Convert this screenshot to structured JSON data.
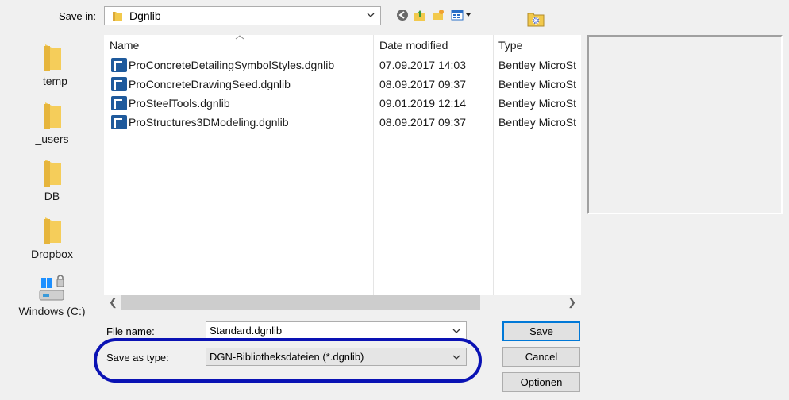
{
  "top": {
    "save_in_label": "Save in:",
    "folder": "Dgnlib"
  },
  "toolbar": {
    "icons": [
      "back-icon",
      "up-folder-icon",
      "new-folder-icon",
      "view-menu-icon",
      "project-folder-icon"
    ]
  },
  "places": [
    {
      "label": "_temp",
      "icon": "folder-icon"
    },
    {
      "label": "_users",
      "icon": "folder-icon"
    },
    {
      "label": "DB",
      "icon": "folder-icon"
    },
    {
      "label": "Dropbox",
      "icon": "folder-icon"
    },
    {
      "label": "Windows (C:)",
      "icon": "drive-icon"
    }
  ],
  "list": {
    "columns": [
      "Name",
      "Date modified",
      "Type"
    ],
    "rows": [
      {
        "name": "ProConcreteDetailingSymbolStyles.dgnlib",
        "date": "07.09.2017 14:03",
        "type": "Bentley MicroSt"
      },
      {
        "name": "ProConcreteDrawingSeed.dgnlib",
        "date": "08.09.2017 09:37",
        "type": "Bentley MicroSt"
      },
      {
        "name": "ProSteelTools.dgnlib",
        "date": "09.01.2019 12:14",
        "type": "Bentley MicroSt"
      },
      {
        "name": "ProStructures3DModeling.dgnlib",
        "date": "08.09.2017 09:37",
        "type": "Bentley MicroSt"
      }
    ]
  },
  "fields": {
    "file_name_label": "File name:",
    "file_name_value": "Standard.dgnlib",
    "save_as_type_label": "Save as type:",
    "save_as_type_value": "DGN-Bibliotheksdateien (*.dgnlib)"
  },
  "buttons": {
    "save": "Save",
    "cancel": "Cancel",
    "options": "Optionen"
  },
  "colors": {
    "highlight": "#0a12b4",
    "primary_border": "#0078d7",
    "file_icon": "#1f5a9c",
    "folder": "#f2c94c"
  }
}
